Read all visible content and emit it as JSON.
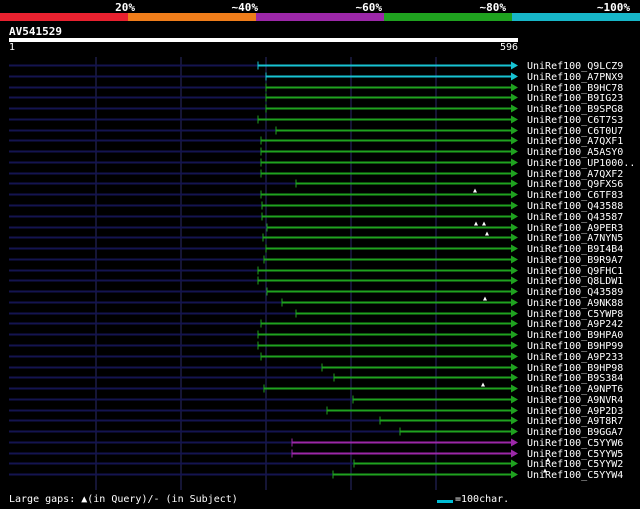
{
  "scale": {
    "labels": [
      "20%",
      "~40%",
      "~60%",
      "~80%",
      "~100%"
    ],
    "colors": [
      "#e8212f",
      "#ef7d1a",
      "#9c27a8",
      "#1fa21f",
      "#17b6c8"
    ]
  },
  "query": {
    "name": "AV541529",
    "start": "1",
    "end": "596"
  },
  "hits": [
    {
      "label": "UniRef100_Q9LCZ9",
      "start": 258,
      "color": "#17c3d3",
      "marks": []
    },
    {
      "label": "UniRef100_A7PNX9",
      "start": 266,
      "color": "#17c3d3",
      "marks": []
    },
    {
      "label": "UniRef100_B9HC78",
      "start": 266,
      "color": "#1fa21f",
      "marks": []
    },
    {
      "label": "UniRef100_B9IG23",
      "start": 266,
      "color": "#1fa21f",
      "marks": []
    },
    {
      "label": "UniRef100_B9SPG8",
      "start": 266,
      "color": "#1fa21f",
      "marks": []
    },
    {
      "label": "UniRef100_C6T7S3",
      "start": 258,
      "color": "#1fa21f",
      "marks": []
    },
    {
      "label": "UniRef100_C6T0U7",
      "start": 276,
      "color": "#1fa21f",
      "marks": []
    },
    {
      "label": "UniRef100_A7QXF1",
      "start": 261,
      "color": "#1fa21f",
      "marks": []
    },
    {
      "label": "UniRef100_A5ASY0",
      "start": 261,
      "color": "#1fa21f",
      "marks": []
    },
    {
      "label": "UniRef100_UP1000..",
      "start": 261,
      "color": "#1fa21f",
      "marks": []
    },
    {
      "label": "UniRef100_A7QXF2",
      "start": 261,
      "color": "#1fa21f",
      "marks": []
    },
    {
      "label": "UniRef100_Q9FXS6",
      "start": 296,
      "color": "#1fa21f",
      "marks": []
    },
    {
      "label": "UniRef100_C6TF83",
      "start": 261,
      "color": "#1fa21f",
      "marks": [
        475
      ]
    },
    {
      "label": "UniRef100_Q43588",
      "start": 262,
      "color": "#1fa21f",
      "marks": []
    },
    {
      "label": "UniRef100_Q43587",
      "start": 262,
      "color": "#1fa21f",
      "marks": []
    },
    {
      "label": "UniRef100_A9PER3",
      "start": 267,
      "color": "#1fa21f",
      "marks": [
        476,
        484
      ]
    },
    {
      "label": "UniRef100_A7NYN5",
      "start": 263,
      "color": "#1fa21f",
      "marks": [
        487
      ]
    },
    {
      "label": "UniRef100_B9I4B4",
      "start": 266,
      "color": "#1fa21f",
      "marks": []
    },
    {
      "label": "UniRef100_B9R9A7",
      "start": 264,
      "color": "#1fa21f",
      "marks": []
    },
    {
      "label": "UniRef100_Q9FHC1",
      "start": 258,
      "color": "#1fa21f",
      "marks": []
    },
    {
      "label": "UniRef100_Q8LDW1",
      "start": 258,
      "color": "#1fa21f",
      "marks": []
    },
    {
      "label": "UniRef100_Q43589",
      "start": 267,
      "color": "#1fa21f",
      "marks": []
    },
    {
      "label": "UniRef100_A9NK88",
      "start": 282,
      "color": "#1fa21f",
      "marks": [
        485
      ]
    },
    {
      "label": "UniRef100_C5YWP8",
      "start": 296,
      "color": "#1fa21f",
      "marks": []
    },
    {
      "label": "UniRef100_A9P242",
      "start": 261,
      "color": "#1fa21f",
      "marks": []
    },
    {
      "label": "UniRef100_B9HPA0",
      "start": 258,
      "color": "#1fa21f",
      "marks": []
    },
    {
      "label": "UniRef100_B9HP99",
      "start": 258,
      "color": "#1fa21f",
      "marks": []
    },
    {
      "label": "UniRef100_A9P233",
      "start": 261,
      "color": "#1fa21f",
      "marks": []
    },
    {
      "label": "UniRef100_B9HP98",
      "start": 322,
      "color": "#1fa21f",
      "marks": []
    },
    {
      "label": "UniRef100_B9S384",
      "start": 334,
      "color": "#1fa21f",
      "marks": []
    },
    {
      "label": "UniRef100_A9NPT6",
      "start": 264,
      "color": "#1fa21f",
      "marks": [
        483
      ]
    },
    {
      "label": "UniRef100_A9NVR4",
      "start": 353,
      "color": "#1fa21f",
      "marks": []
    },
    {
      "label": "UniRef100_A9P2D3",
      "start": 327,
      "color": "#1fa21f",
      "marks": []
    },
    {
      "label": "UniRef100_A9T8R7",
      "start": 380,
      "color": "#1fa21f",
      "marks": []
    },
    {
      "label": "UniRef100_B9GGA7",
      "start": 400,
      "color": "#1fa21f",
      "marks": []
    },
    {
      "label": "UniRef100_C5YYW6",
      "start": 292,
      "color": "#9c27a8",
      "marks": []
    },
    {
      "label": "UniRef100_C5YYW5",
      "start": 292,
      "color": "#9c27a8",
      "marks": []
    },
    {
      "label": "UniRef100_C5YYW2",
      "start": 354,
      "color": "#1fa21f",
      "marks": [
        548
      ]
    },
    {
      "label": "UniRef100_C5YYW4",
      "start": 333,
      "color": "#1fa21f",
      "marks": [
        545
      ]
    }
  ],
  "footer": {
    "gaps_text": "Large gaps: ▲(in Query)/- (in Subject)",
    "legend_text": "=100char."
  }
}
